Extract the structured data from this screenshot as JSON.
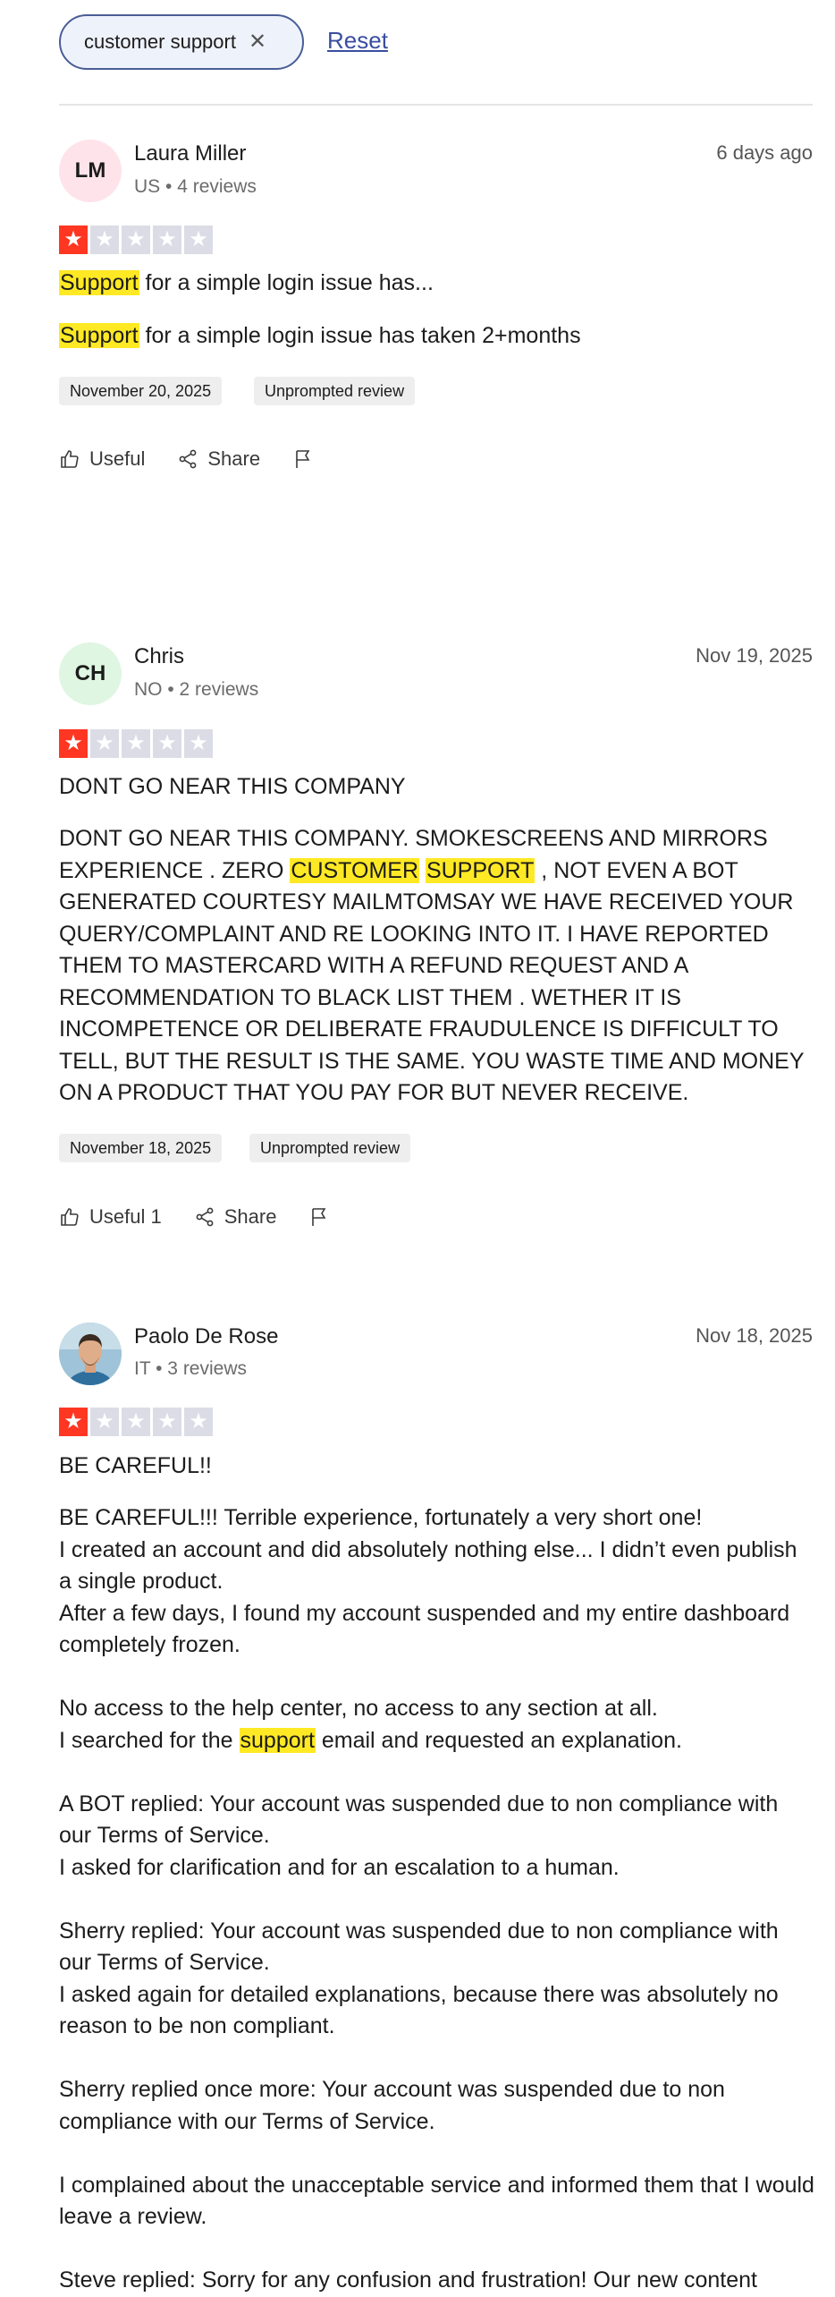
{
  "filter": {
    "chip_label": "customer support",
    "reset_label": "Reset"
  },
  "reviews": [
    {
      "initials": "LM",
      "name": "Laura Miller",
      "meta": "US • 4 reviews",
      "date": "6 days ago",
      "rating": 1,
      "title_hl": "Support",
      "title_rest": " for a simple login issue has...",
      "body_hl": "Support",
      "body_rest": " for a simple login issue has taken 2+months",
      "experience_date": "November 20, 2025",
      "badge": "Unprompted review",
      "useful_label": "Useful",
      "share_label": "Share"
    },
    {
      "initials": "CH",
      "name": "Chris",
      "meta": "NO • 2 reviews",
      "date": "Nov 19, 2025",
      "rating": 1,
      "title": "DONT GO NEAR THIS COMPANY",
      "body_a": "DONT GO NEAR THIS COMPANY. SMOKESCREENS AND MIRRORS EXPERIENCE . ZERO ",
      "body_hl1": "CUSTOMER",
      "body_hl2": "SUPPORT",
      "body_b": " , NOT EVEN A BOT GENERATED COURTESY MAILMTOMSAY WE HAVE RECEIVED YOUR QUERY/COMPLAINT AND RE LOOKING INTO IT. I HAVE REPORTED THEM TO MASTERCARD WITH A REFUND REQUEST AND A RECOMMENDATION TO BLACK LIST THEM . WETHER IT IS INCOMPETENCE OR DELIBERATE FRAUDULENCE IS DIFFICULT TO TELL, BUT THE RESULT IS THE SAME. YOU WASTE TIME AND MONEY ON A PRODUCT THAT YOU PAY FOR BUT NEVER RECEIVE.",
      "experience_date": "November 18, 2025",
      "badge": "Unprompted review",
      "useful_label": "Useful 1",
      "share_label": "Share"
    },
    {
      "name": "Paolo De Rose",
      "meta": "IT • 3 reviews",
      "date": "Nov 18, 2025",
      "rating": 1,
      "title": "BE CAREFUL!!",
      "p1": "BE CAREFUL!!! Terrible experience, fortunately a very short one!",
      "p2": "I created an account and did absolutely nothing else... I didn’t even publish a single product.",
      "p3": "After a few days, I found my account suspended and my entire dashboard completely frozen.",
      "p4": "No access to the help center, no access to any section at all.",
      "p5a": "I searched for the ",
      "p5hl": "support",
      "p5b": " email and requested an explanation.",
      "p6": "A BOT replied: Your account was suspended due to non compliance with our Terms of Service.",
      "p7": "I asked for clarification and for an escalation to a human.",
      "p8": "Sherry replied: Your account was suspended due to non compliance with our Terms of Service.",
      "p9": "I asked again for detailed explanations, because there was absolutely no reason to be non compliant.",
      "p10": "Sherry replied once more: Your account was suspended due to non compliance with our Terms of Service.",
      "p11": "I complained about the unacceptable service and informed them that I would leave a review.",
      "p12": "Steve replied: Sorry for any confusion and frustration! Our new content"
    }
  ]
}
